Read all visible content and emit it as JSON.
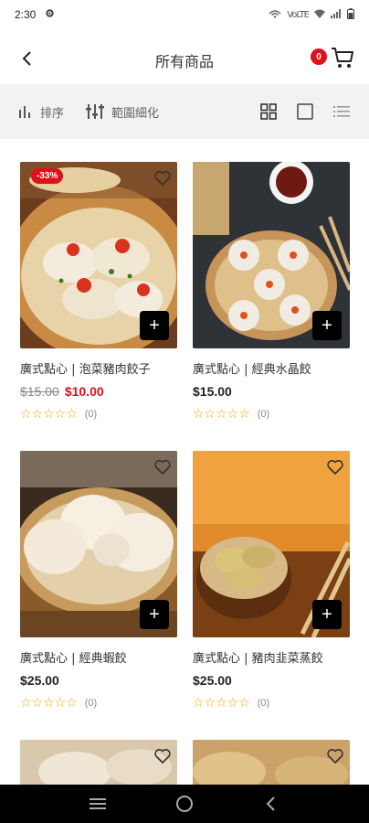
{
  "status": {
    "time": "2:30",
    "right_text": "VoLTE"
  },
  "header": {
    "title": "所有商品",
    "cart_count": "0"
  },
  "toolbar": {
    "sort_label": "排序",
    "filter_label": "範圍細化"
  },
  "products": [
    {
      "name": "廣式點心 | 泡菜豬肉餃子",
      "old_price": "$15.00",
      "price": "$10.00",
      "discount": "-33%",
      "rating_count": "(0)",
      "add": "+"
    },
    {
      "name": "廣式點心 | 經典水晶餃",
      "price": "$15.00",
      "rating_count": "(0)",
      "add": "+"
    },
    {
      "name": "廣式點心 | 經典蝦餃",
      "price": "$25.00",
      "rating_count": "(0)",
      "add": "+"
    },
    {
      "name": "廣式點心 | 豬肉韭菜蒸餃",
      "price": "$25.00",
      "rating_count": "(0)",
      "add": "+"
    }
  ],
  "stars": "☆☆☆☆☆",
  "colors": {
    "accent": "#e0101a",
    "toolbar_bg": "#f2f2f2",
    "nav_bg": "#000000"
  }
}
